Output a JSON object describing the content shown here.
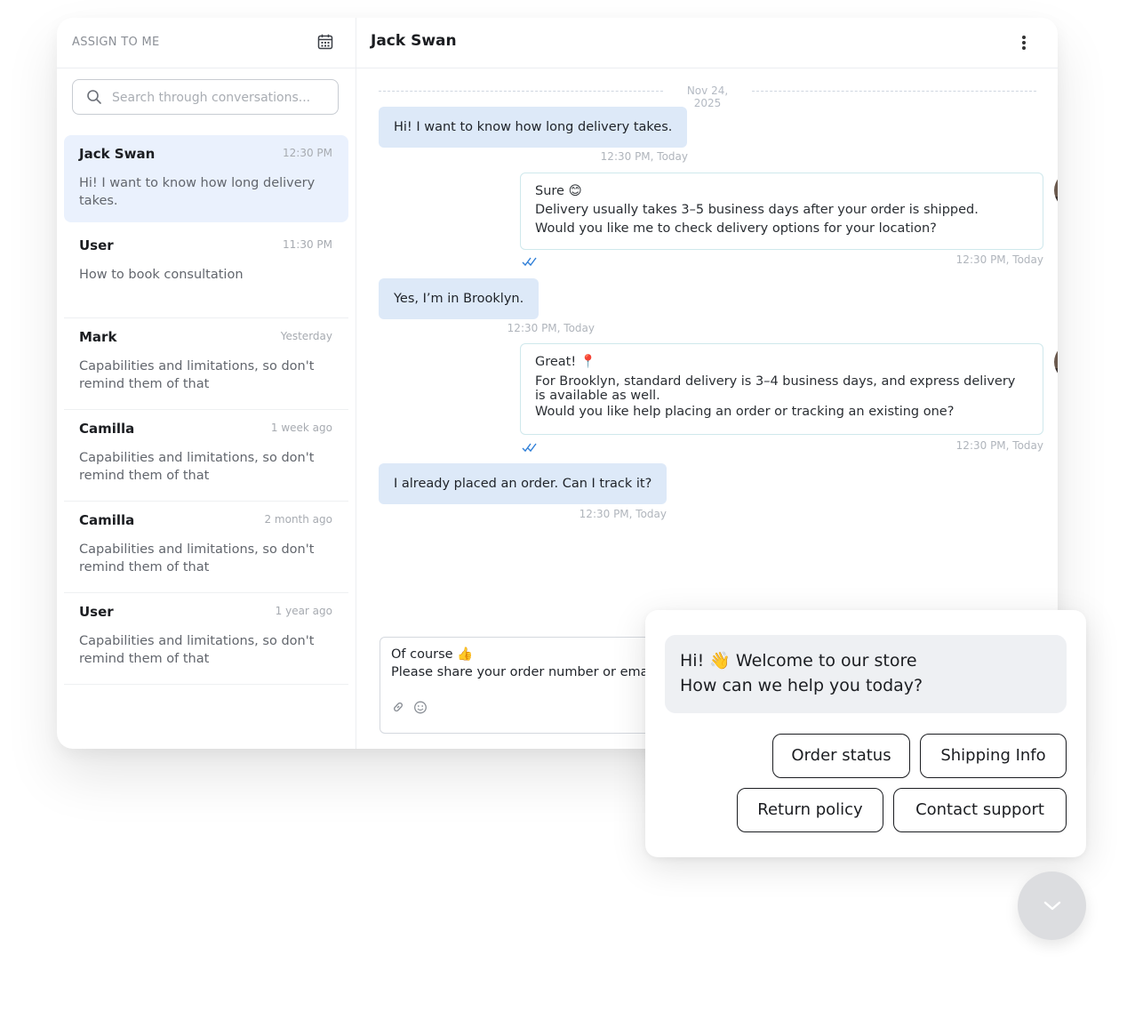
{
  "sidebar": {
    "title": "ASSIGN TO ME",
    "search_placeholder": "Search through conversations...",
    "conversations": [
      {
        "name": "Jack Swan",
        "time": "12:30 PM",
        "message": "Hi! I want to know how long delivery takes."
      },
      {
        "name": "User",
        "time": "11:30 PM",
        "message": "How to book consultation"
      },
      {
        "name": "Mark",
        "time": "Yesterday",
        "message": "Capabilities and limitations, so don't remind them of that"
      },
      {
        "name": "Camilla",
        "time": "1 week ago",
        "message": "Capabilities and limitations, so don't remind them of that"
      },
      {
        "name": "Camilla",
        "time": "2 month ago",
        "message": "Capabilities and limitations, so don't remind them of that"
      },
      {
        "name": "User",
        "time": "1 year ago",
        "message": "Capabilities and limitations, so don't remind them of that"
      }
    ]
  },
  "chat": {
    "contact_name": "Jack Swan",
    "date": "Nov 24, 2025",
    "messages": [
      {
        "text": "Hi! I want to know how long delivery takes.",
        "time": "12:30 PM, Today"
      },
      {
        "lines": [
          "Sure 😊",
          "Delivery usually takes 3–5 business days after your order is shipped.",
          "Would you like me to check delivery options for your location?"
        ],
        "time": "12:30 PM, Today"
      },
      {
        "text": "Yes, I’m in Brooklyn.",
        "time": "12:30 PM, Today"
      },
      {
        "lines": [
          "Great! 📍",
          "For Brooklyn, standard delivery is 3–4 business days, and express delivery is available as well.",
          "Would you like help placing an order or tracking an existing one?"
        ],
        "time": "12:30 PM, Today"
      },
      {
        "text": "I already placed an order. Can I track it?",
        "time": "12:30 PM, Today"
      }
    ],
    "composer": {
      "line1": "Of course 👍",
      "line2": "Please share your order number or email address"
    }
  },
  "widget": {
    "greeting_line1": "Hi! 👋 Welcome to our store",
    "greeting_line2": "How can we help you today?",
    "quick_replies": [
      "Order status",
      "Shipping Info",
      "Return policy",
      "Contact support"
    ]
  },
  "colors": {
    "incoming_bubble": "#dde9f8",
    "outgoing_border": "#cfe8ec",
    "active_conversation": "#eaf1fd",
    "read_ticks": "#2f7fd8"
  }
}
